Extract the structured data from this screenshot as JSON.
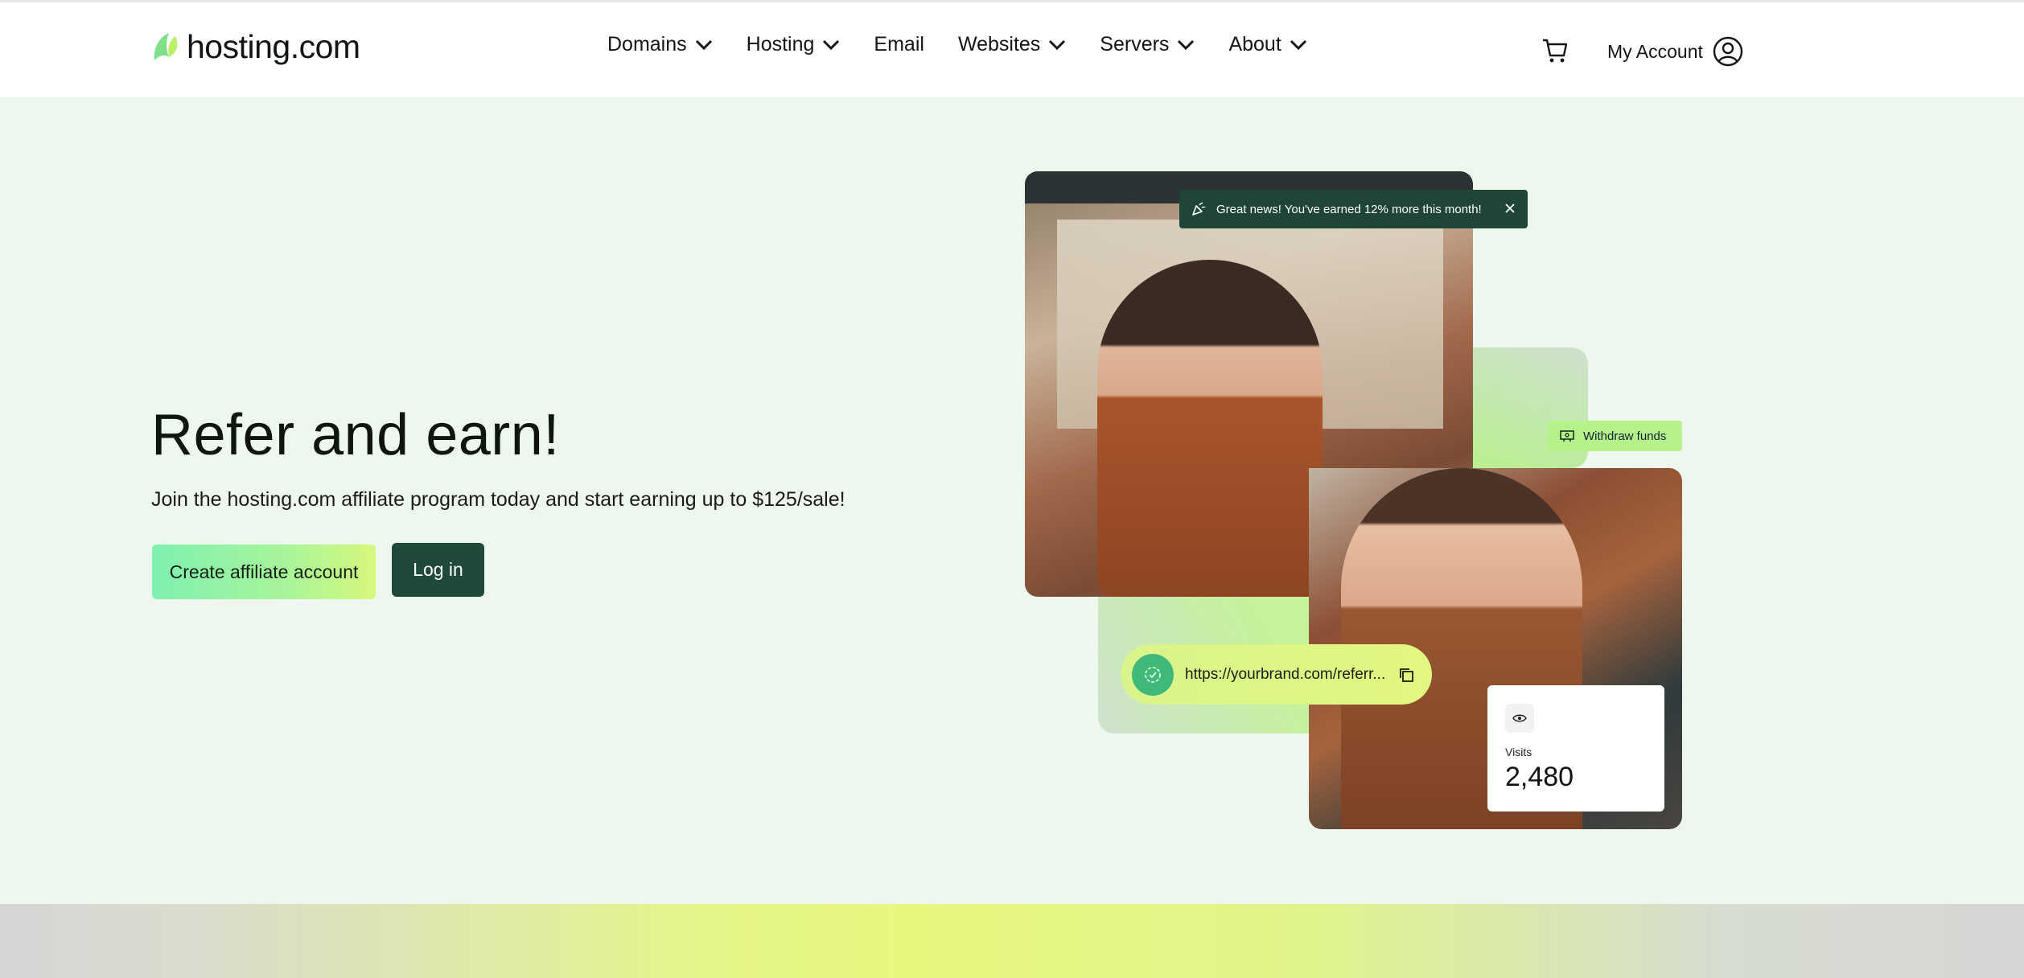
{
  "header": {
    "logo_text": "hosting.com",
    "nav": [
      {
        "label": "Domains",
        "has_dropdown": true
      },
      {
        "label": "Hosting",
        "has_dropdown": true
      },
      {
        "label": "Email",
        "has_dropdown": false
      },
      {
        "label": "Websites",
        "has_dropdown": true
      },
      {
        "label": "Servers",
        "has_dropdown": true
      },
      {
        "label": "About",
        "has_dropdown": true
      }
    ],
    "cart_icon": "shopping-cart-icon",
    "account_label": "My Account",
    "account_icon": "user-circle-icon"
  },
  "hero": {
    "title": "Refer and earn!",
    "subtitle": "Join the hosting.com affiliate program today and start earning up to $125/sale!",
    "create_button": "Create affiliate account",
    "login_button": "Log in"
  },
  "collage": {
    "toast_text": "Great news! You've earned 12% more this month!",
    "toast_icon": "party-popper-icon",
    "withdraw_label": "Withdraw funds",
    "withdraw_icon": "money-icon",
    "referral_url": "https://yourbrand.com/referr...",
    "badge_icon": "verified-badge-icon",
    "copy_icon": "copy-icon",
    "visits_label": "Visits",
    "visits_value": "2,480",
    "eye_icon": "eye-icon"
  },
  "colors": {
    "accent_dark": "#1f4a3a",
    "accent_green": "#b6f28a",
    "hero_background": "#eef7ee"
  }
}
